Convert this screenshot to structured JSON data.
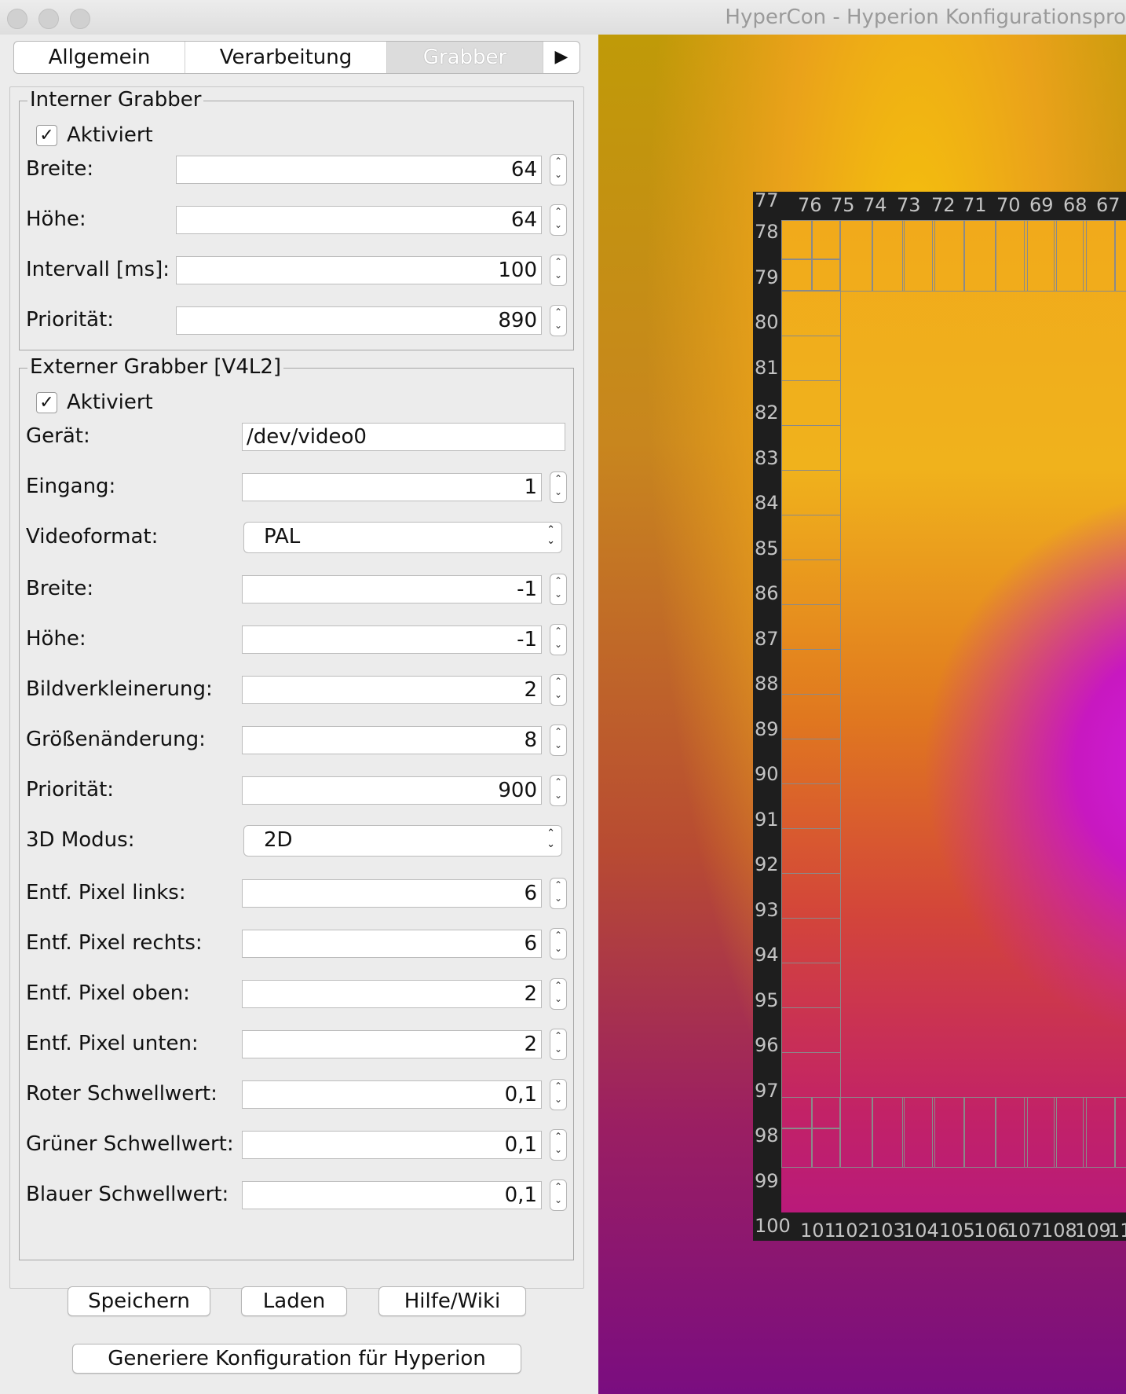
{
  "window": {
    "title": "HyperCon - Hyperion Konfigurationspro"
  },
  "tabs": {
    "items": [
      "Allgemein",
      "Verarbeitung",
      "Grabber"
    ],
    "more": "▶"
  },
  "internal": {
    "title": "Interner Grabber",
    "enabled_label": "Aktiviert",
    "enabled": true,
    "fields": [
      {
        "label": "Breite:",
        "value": "64"
      },
      {
        "label": "Höhe:",
        "value": "64"
      },
      {
        "label": "Intervall [ms]:",
        "value": "100"
      },
      {
        "label": "Priorität:",
        "value": "890"
      }
    ]
  },
  "external": {
    "title": "Externer Grabber [V4L2]",
    "enabled_label": "Aktiviert",
    "enabled": true,
    "device": {
      "label": "Gerät:",
      "value": "/dev/video0"
    },
    "input": {
      "label": "Eingang:",
      "value": "1"
    },
    "videoformat": {
      "label": "Videoformat:",
      "value": "PAL"
    },
    "width": {
      "label": "Breite:",
      "value": "-1"
    },
    "height": {
      "label": "Höhe:",
      "value": "-1"
    },
    "decimation": {
      "label": "Bildverkleinerung:",
      "value": "2"
    },
    "resize": {
      "label": "Größenänderung:",
      "value": "8"
    },
    "priority": {
      "label": "Priorität:",
      "value": "900"
    },
    "mode3d": {
      "label": "3D Modus:",
      "value": "2D"
    },
    "crop": [
      {
        "label": "Entf. Pixel links:",
        "value": "6"
      },
      {
        "label": "Entf. Pixel rechts:",
        "value": "6"
      },
      {
        "label": "Entf. Pixel oben:",
        "value": "2"
      },
      {
        "label": "Entf. Pixel unten:",
        "value": "2"
      },
      {
        "label": "Roter Schwellwert:",
        "value": "0,1"
      },
      {
        "label": "Grüner Schwellwert:",
        "value": "0,1"
      },
      {
        "label": "Blauer Schwellwert:",
        "value": "0,1"
      }
    ]
  },
  "buttons": {
    "save": "Speichern",
    "load": "Laden",
    "help": "Hilfe/Wiki",
    "generate": "Generiere Konfiguration für Hyperion"
  },
  "preview": {
    "top_indices": [
      "77",
      "76",
      "75",
      "74",
      "73",
      "72",
      "71",
      "70",
      "69",
      "68",
      "67"
    ],
    "left_indices": [
      "78",
      "79",
      "80",
      "81",
      "82",
      "83",
      "84",
      "85",
      "86",
      "87",
      "88",
      "89",
      "90",
      "91",
      "92",
      "93",
      "94",
      "95",
      "96",
      "97",
      "98",
      "99",
      "100"
    ],
    "bottom_indices": [
      "101",
      "102",
      "103",
      "104",
      "105",
      "106",
      "107",
      "108",
      "109",
      "11"
    ]
  }
}
